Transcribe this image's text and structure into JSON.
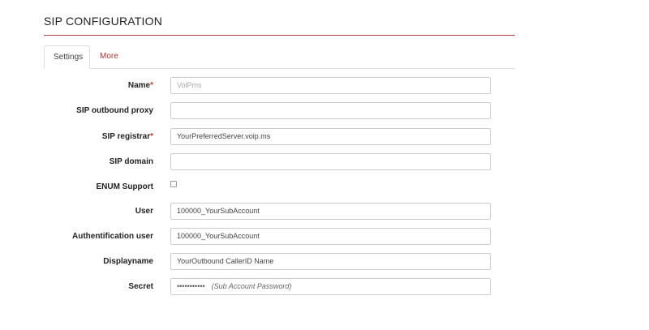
{
  "page": {
    "title": "SIP CONFIGURATION"
  },
  "tabs": [
    {
      "label": "Settings",
      "active": true
    },
    {
      "label": "More",
      "active": false
    }
  ],
  "colors": {
    "accent": "#a9343a",
    "required": "#c0392b",
    "rule": "#b5474d"
  },
  "form": {
    "name": {
      "label": "Name",
      "required": "*",
      "placeholder": "VolPms",
      "value": ""
    },
    "outbound_proxy": {
      "label": "SIP outbound proxy",
      "value": ""
    },
    "registrar": {
      "label": "SIP registrar",
      "required": "*",
      "value": "YourPreferredServer.voip.ms"
    },
    "domain": {
      "label": "SIP domain",
      "value": ""
    },
    "enum_support": {
      "label": "ENUM Support",
      "checked": false
    },
    "user": {
      "label": "User",
      "value": "100000_YourSubAccount"
    },
    "auth_user": {
      "label": "Authentification user",
      "value": "100000_YourSubAccount"
    },
    "displayname": {
      "label": "Displayname",
      "value": "YourOutbound CallerID Name"
    },
    "secret": {
      "label": "Secret",
      "masked_value": "•••••••••••",
      "hint": "(Sub Account Password)"
    }
  }
}
